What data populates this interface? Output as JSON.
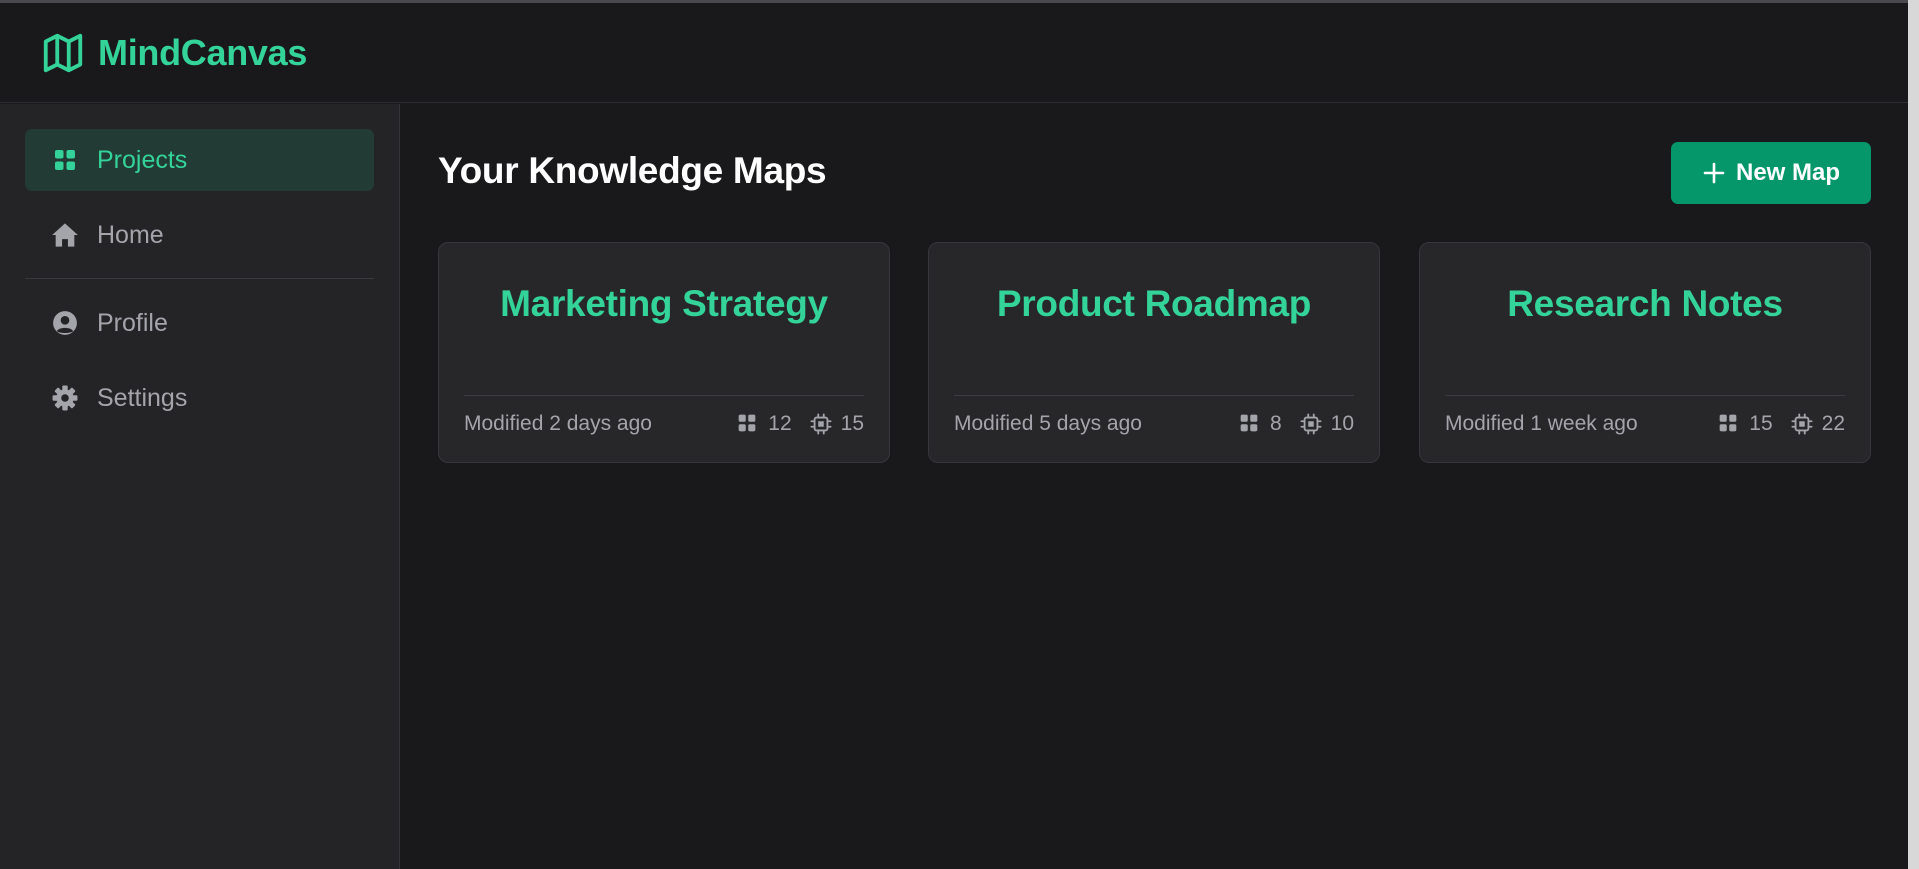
{
  "app": {
    "name": "MindCanvas"
  },
  "sidebar": {
    "items": [
      {
        "label": "Projects",
        "icon": "grid-icon",
        "active": true
      },
      {
        "label": "Home",
        "icon": "home-icon",
        "active": false
      },
      {
        "label": "Profile",
        "icon": "user-circle-icon",
        "active": false
      },
      {
        "label": "Settings",
        "icon": "gear-icon",
        "active": false
      }
    ]
  },
  "main": {
    "title": "Your Knowledge Maps",
    "new_button": {
      "label": "New Map",
      "icon": "plus-icon"
    }
  },
  "cards": [
    {
      "title": "Marketing Strategy",
      "modified": "Modified 2 days ago",
      "nodes": "12",
      "connections": "15"
    },
    {
      "title": "Product Roadmap",
      "modified": "Modified 5 days ago",
      "nodes": "8",
      "connections": "10"
    },
    {
      "title": "Research Notes",
      "modified": "Modified 1 week ago",
      "nodes": "15",
      "connections": "22"
    }
  ],
  "colors": {
    "accent": "#34d399",
    "button": "#059669",
    "background": "#19191b",
    "sidebar": "#242427",
    "card": "#27272a"
  }
}
